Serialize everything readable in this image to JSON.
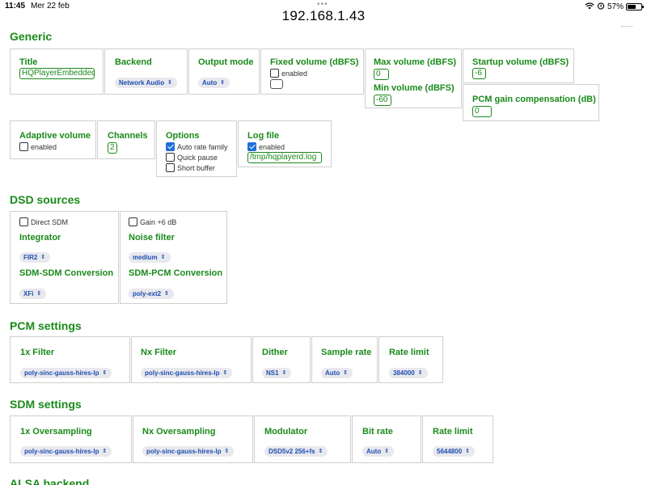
{
  "status_bar": {
    "time": "11:45",
    "date": "Mer 22 feb",
    "url": "192.168.1.43",
    "battery": "57%"
  },
  "generic": {
    "title": "Generic",
    "title_label": "Title",
    "title_value": "HQPlayerEmbedded",
    "backend_label": "Backend",
    "backend_value": "Network Audio",
    "output_mode_label": "Output mode",
    "output_mode_value": "Auto",
    "fixed_volume_label": "Fixed volume (dBFS)",
    "fixed_volume_enabled": "enabled",
    "max_volume_label": "Max volume (dBFS)",
    "max_volume_value": "0",
    "min_volume_label": "Min volume (dBFS)",
    "min_volume_value": "-60",
    "startup_volume_label": "Startup volume (dBFS)",
    "startup_volume_value": "-6",
    "pcm_gain_label": "PCM gain compensation (dB)",
    "pcm_gain_value": "0",
    "adaptive_volume_label": "Adaptive volume",
    "adaptive_volume_enabled": "enabled",
    "channels_label": "Channels",
    "channels_value": "2",
    "options_label": "Options",
    "option_auto_rate": "Auto rate family",
    "option_quick_pause": "Quick pause",
    "option_short_buffer": "Short buffer",
    "log_file_label": "Log file",
    "log_file_enabled": "enabled",
    "log_file_value": "/tmp/hqplayerd.log"
  },
  "dsd": {
    "title": "DSD sources",
    "direct_sdm": "Direct SDM",
    "gain_6db": "Gain +6 dB",
    "integrator_label": "Integrator",
    "integrator_value": "FIR2",
    "noise_filter_label": "Noise filter",
    "noise_filter_value": "medium",
    "sdm_sdm_label": "SDM-SDM Conversion",
    "sdm_sdm_value": "XFi",
    "sdm_pcm_label": "SDM-PCM Conversion",
    "sdm_pcm_value": "poly-ext2"
  },
  "pcm": {
    "title": "PCM settings",
    "filter1x_label": "1x Filter",
    "filter1x_value": "poly-sinc-gauss-hires-lp",
    "filternx_label": "Nx Filter",
    "filternx_value": "poly-sinc-gauss-hires-lp",
    "dither_label": "Dither",
    "dither_value": "NS1",
    "sample_rate_label": "Sample rate",
    "sample_rate_value": "Auto",
    "rate_limit_label": "Rate limit",
    "rate_limit_value": "384000"
  },
  "sdm": {
    "title": "SDM settings",
    "os1x_label": "1x Oversampling",
    "os1x_value": "poly-sinc-gauss-hires-lp",
    "osnx_label": "Nx Oversampling",
    "osnx_value": "poly-sinc-gauss-hires-lp",
    "modulator_label": "Modulator",
    "modulator_value": "DSD5v2 256+fs",
    "bit_rate_label": "Bit rate",
    "bit_rate_value": "Auto",
    "rate_limit_label": "Rate limit",
    "rate_limit_value": "5644800"
  },
  "alsa": {
    "title": "ALSA backend"
  },
  "icons": {
    "select_chevron": "chevron-updown-icon",
    "wifi": "wifi-icon",
    "alarm": "alarm-icon",
    "battery": "battery-icon"
  },
  "colors": {
    "accent_green": "#1a8a1a",
    "select_text_blue": "#1e4fb0",
    "checkbox_blue": "#1e6fd9"
  }
}
